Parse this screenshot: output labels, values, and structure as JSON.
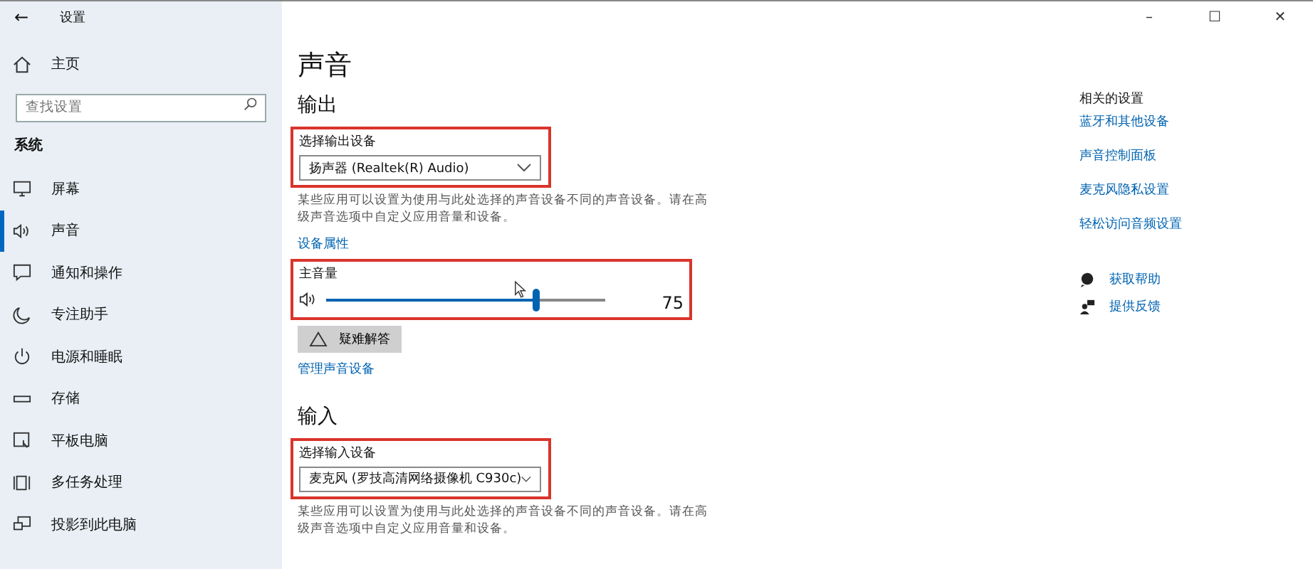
{
  "window": {
    "title": "设置",
    "back": "←",
    "controls": [
      "–",
      "☐",
      "✕"
    ]
  },
  "sidebar": {
    "home": "主页",
    "search": {
      "placeholder": "查找设置"
    },
    "section": "系统",
    "items": [
      {
        "label": "屏幕",
        "kind": "monitor",
        "selected": false
      },
      {
        "label": "声音",
        "kind": "speaker",
        "selected": true
      },
      {
        "label": "通知和操作",
        "kind": "message",
        "selected": false
      },
      {
        "label": "专注助手",
        "kind": "moon",
        "selected": false
      },
      {
        "label": "电源和睡眠",
        "kind": "power",
        "selected": false
      },
      {
        "label": "存储",
        "kind": "storage",
        "selected": false
      },
      {
        "label": "平板电脑",
        "kind": "tablet",
        "selected": false
      },
      {
        "label": "多任务处理",
        "kind": "multitask",
        "selected": false
      },
      {
        "label": "投影到此电脑",
        "kind": "project",
        "selected": false
      }
    ]
  },
  "main": {
    "title": "声音",
    "output": {
      "heading": "输出",
      "device_label": "选择输出设备",
      "device": "扬声器 (Realtek(R) Audio)",
      "highlighted": true,
      "note": "某些应用可以设置为使用与此处选择的声音设备不同的声音设备。请在高级声音选项中自定义应用音量和设备。",
      "properties_link": "设备属性",
      "volume": {
        "label": "主音量",
        "level": 0.75,
        "reading": "75",
        "highlighted": true
      },
      "troubleshoot_button": "疑难解答",
      "manage_link": "管理声音设备"
    },
    "input": {
      "heading": "输入",
      "device_label": "选择输入设备",
      "device": "麦克风 (罗技高清网络摄像机 C930c)",
      "highlighted": true,
      "note": "某些应用可以设置为使用与此处选择的声音设备不同的声音设备。请在高级声音选项中自定义应用音量和设备。"
    }
  },
  "related": {
    "heading": "相关的设置",
    "links": [
      "蓝牙和其他设备",
      "声音控制面板",
      "麦克风隐私设置",
      "轻松访问音频设置"
    ],
    "help": [
      {
        "label": "获取帮助",
        "kind": "help"
      },
      {
        "label": "提供反馈",
        "kind": "feedback"
      }
    ]
  }
}
